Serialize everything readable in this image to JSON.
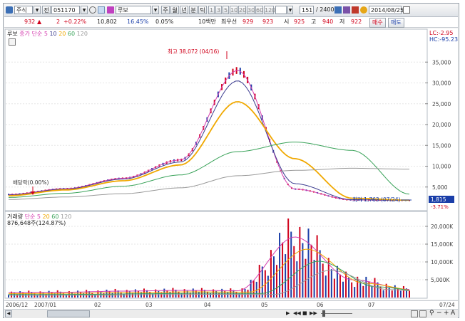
{
  "toolbar": {
    "market_type": "주식",
    "code_label": "전",
    "code_value": "051170",
    "stock_name": "루보",
    "period_buttons": [
      "주",
      "월",
      "년",
      "분",
      "틱"
    ],
    "minute_buttons": [
      "1",
      "3",
      "5",
      "10",
      "20",
      "30",
      "60",
      "120"
    ],
    "count_value": "151",
    "count_total": "/ 2400",
    "date_value": "2014/08/25"
  },
  "infobar": {
    "price": "932",
    "change_arrow": "▲",
    "change": "2",
    "change_pct": "+0.22%",
    "volume": "10,802",
    "ratio1": "16.45%",
    "ratio2": "0.05%",
    "unit": "10백만",
    "best_ask_label": "최우선",
    "best_ask": "929",
    "best_bid": "923",
    "open_label": "시",
    "open": "925",
    "high_label": "고",
    "high": "940",
    "low_label": "저",
    "low": "922",
    "buy_label": "매수",
    "sell_label": "매도"
  },
  "colors": {
    "up": "#d0021b",
    "down": "#1a3ea8",
    "ma5": "#d63fb0",
    "ma10": "#3b3b8f",
    "ma20": "#f0a800",
    "ma60": "#3aa35a",
    "ma120": "#9a9a9a"
  },
  "price_pane": {
    "legend_name": "루보",
    "legend_ma": "종가 단순",
    "legend_periods": [
      "5",
      "10",
      "20",
      "60",
      "120"
    ],
    "lc_label": "LC:-2.95",
    "hc_label": "HC:-95.23",
    "max_label": "최고 38,072 (04/16)",
    "min_label": "최저 1,763 (07/24)",
    "dividend_label": "배당락(0.00%)",
    "current_price_tag": "1,815",
    "current_pct_tag": "-3.71%"
  },
  "volume_pane": {
    "legend_name": "거래량",
    "legend_ma": "단순",
    "legend_periods": [
      "5",
      "20",
      "60",
      "120"
    ],
    "value_label": "876,648주(124.87%)"
  },
  "x_axis": {
    "labels": [
      "2006/12",
      "2007/01",
      "02",
      "03",
      "04",
      "05",
      "06",
      "07"
    ],
    "end_label": "07/24"
  },
  "chart_data": [
    {
      "type": "line",
      "title": "",
      "x": [
        "2006/12",
        "2007/01",
        "02",
        "03",
        "04",
        "05",
        "06",
        "07"
      ],
      "y_ticks": [
        5000,
        10000,
        15000,
        20000,
        25000,
        30000,
        35000
      ],
      "ylim": [
        0,
        40000
      ],
      "series": [
        {
          "name": "5",
          "values": [
            3200,
            4600,
            7100,
            11500,
            33000,
            4500,
            1900,
            1800
          ]
        },
        {
          "name": "10",
          "values": [
            3100,
            4500,
            6900,
            11000,
            30500,
            5800,
            1950,
            1800
          ]
        },
        {
          "name": "20",
          "values": [
            2900,
            4300,
            6500,
            10300,
            25500,
            11800,
            2300,
            1850
          ]
        },
        {
          "name": "60",
          "values": [
            2500,
            3500,
            5200,
            7900,
            13500,
            15800,
            13800,
            3300
          ]
        },
        {
          "name": "120",
          "values": [
            2000,
            2600,
            3400,
            4800,
            7700,
            9000,
            9500,
            9300
          ]
        }
      ],
      "annotations": {
        "max": 38072,
        "max_date": "04/16",
        "min": 1763,
        "min_date": "07/24",
        "last": 1815
      }
    },
    {
      "type": "bar",
      "title": "",
      "x": [
        "2006/12",
        "2007/01",
        "02",
        "03",
        "04",
        "05",
        "06",
        "07"
      ],
      "y_ticks": [
        5000,
        10000,
        15000,
        20000
      ],
      "y_tick_labels": [
        "5,000K",
        "10,000K",
        "15,000K",
        "20,000K"
      ],
      "ylim": [
        0,
        22000
      ],
      "values_k": [
        1400,
        1500,
        1800,
        2000,
        1900,
        17000,
        5000,
        2300
      ]
    }
  ],
  "price_axis_labels": [
    "35,000",
    "30,000",
    "25,000",
    "20,000",
    "15,000",
    "10,000",
    "5,000"
  ],
  "volume_axis_labels": [
    "20,000K",
    "15,000K",
    "10,000K",
    "5,000K"
  ]
}
